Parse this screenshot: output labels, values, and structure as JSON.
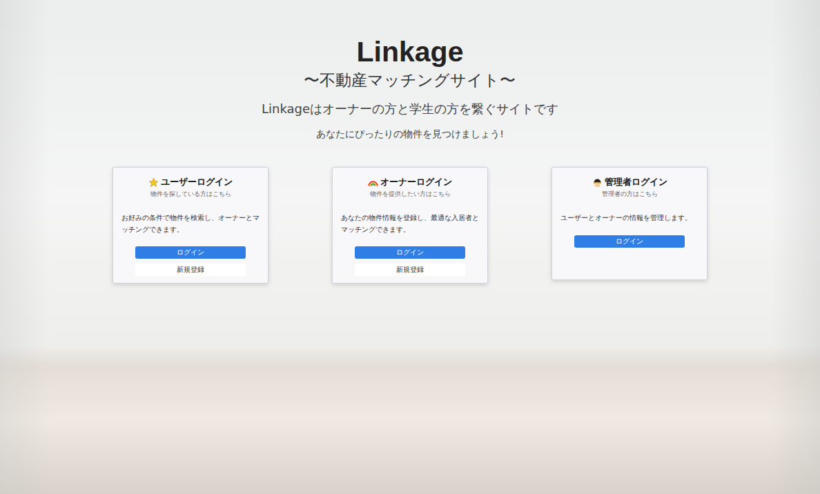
{
  "header": {
    "title": "Linkage",
    "tagline": "〜不動産マッチングサイト〜",
    "description": "Linkageはオーナーの方と学生の方を繋ぐサイトです",
    "prompt": "あなたにぴったりの物件を見つけましょう!"
  },
  "cards": [
    {
      "title": "ユーザーログイン",
      "subtitle": "物件を探している方はこちら",
      "description": "お好みの条件で物件を検索し、オーナーとマッチングできます。",
      "buttons": [
        {
          "label": "ログイン",
          "kind": "primary"
        },
        {
          "label": "新規登録",
          "kind": "secondary"
        }
      ]
    },
    {
      "title": "オーナーログイン",
      "subtitle": "物件を提供したい方はこちら",
      "description": "あなたの物件情報を登録し、最適な入居者とマッチングできます。",
      "buttons": [
        {
          "label": "ログイン",
          "kind": "primary"
        },
        {
          "label": "新規登録",
          "kind": "secondary"
        }
      ]
    },
    {
      "title": "管理者ログイン",
      "subtitle": "管理者の方はこちら",
      "description": "ユーザーとオーナーの情報を管理します。",
      "buttons": [
        {
          "label": "ログイン",
          "kind": "primary"
        }
      ]
    }
  ]
}
